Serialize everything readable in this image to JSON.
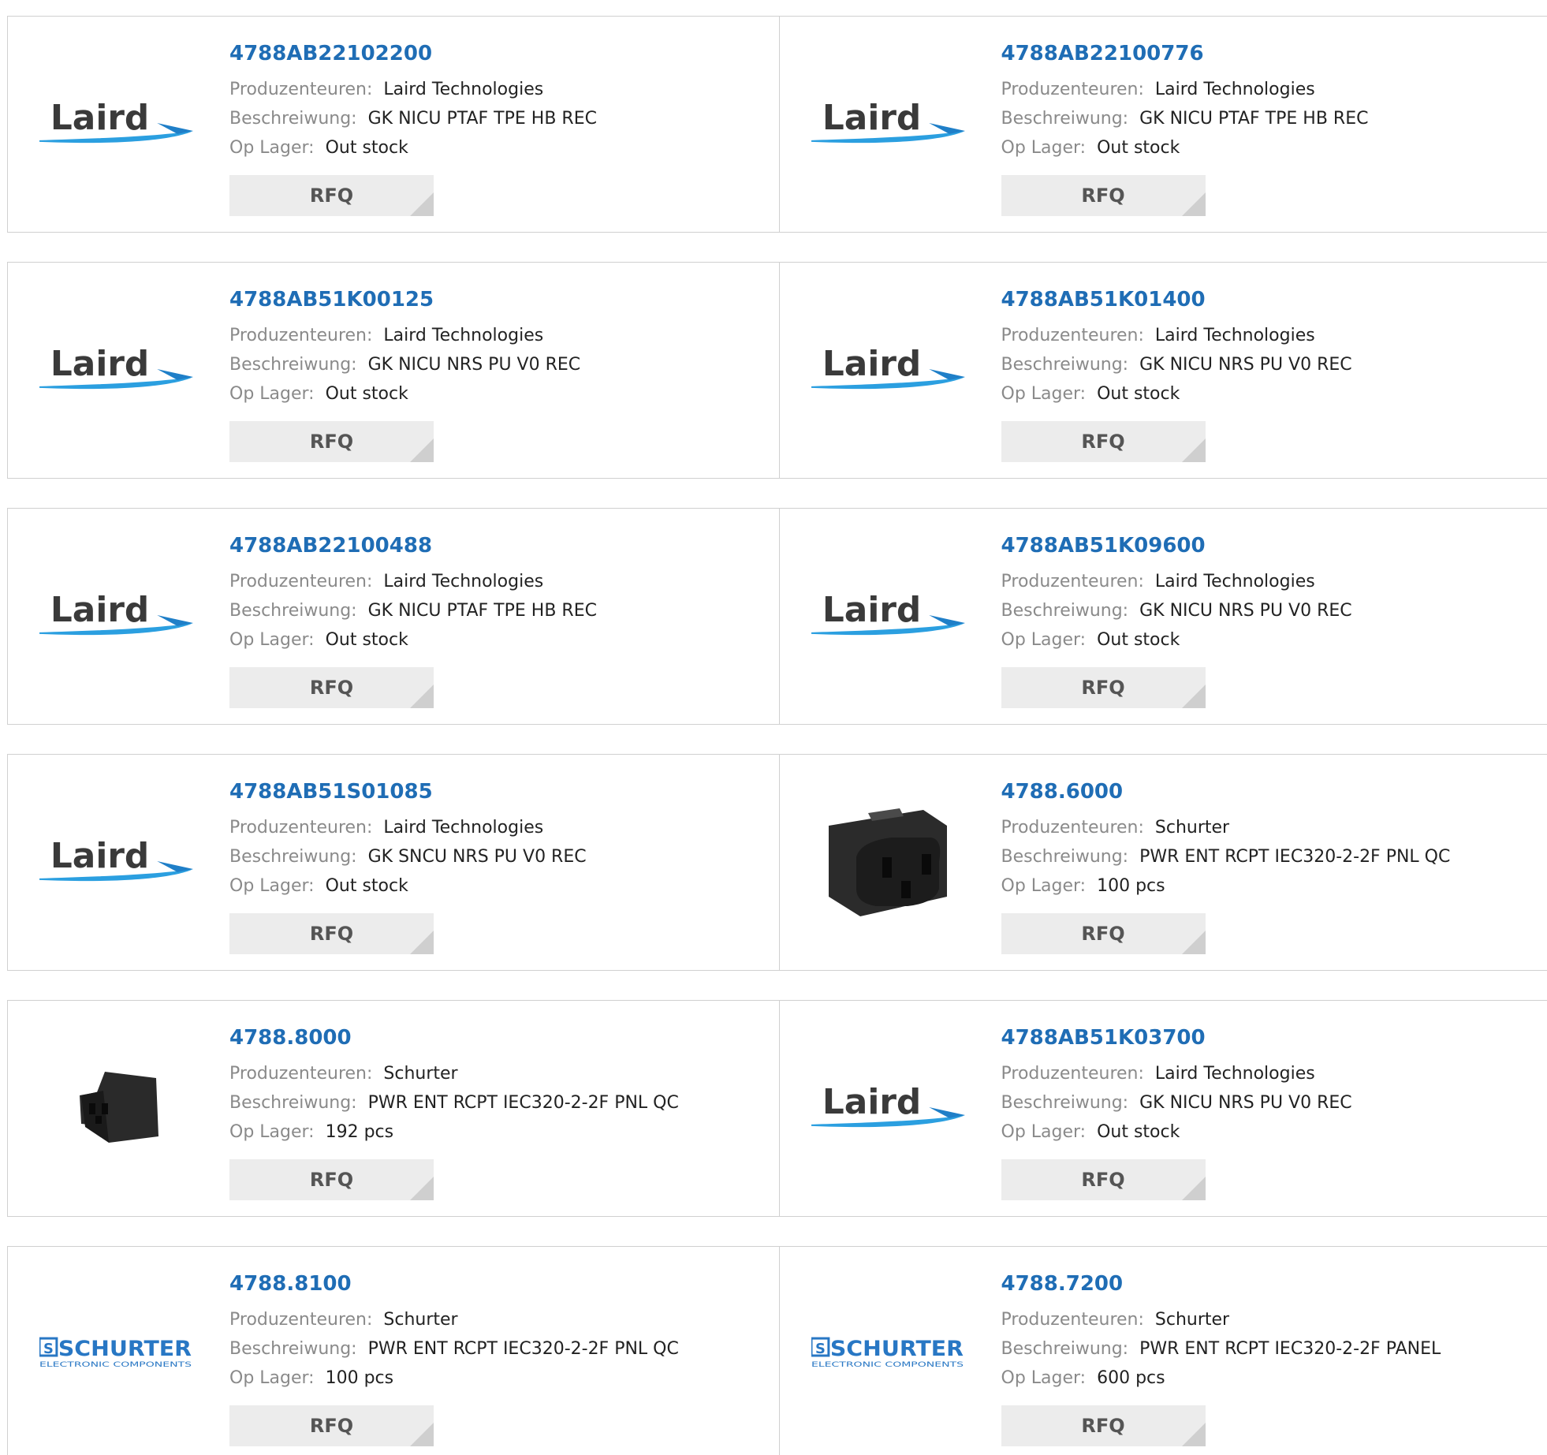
{
  "labels": {
    "manufacturer": "Produzenteuren:",
    "description": "Beschreiwung:",
    "stock": "Op Lager:",
    "rfq": "RFQ"
  },
  "brand": {
    "laird_word": "Laird",
    "schurter_word": "SCHURTER",
    "schurter_sub": "ELECTRONIC COMPONENTS",
    "link_color": "#1f6db5"
  },
  "products": [
    {
      "part": "4788AB22102200",
      "manufacturer": "Laird Technologies",
      "description": "GK NICU PTAF TPE HB REC",
      "stock": "Out stock",
      "image": "laird-logo"
    },
    {
      "part": "4788AB22100776",
      "manufacturer": "Laird Technologies",
      "description": "GK NICU PTAF TPE HB REC",
      "stock": "Out stock",
      "image": "laird-logo"
    },
    {
      "part": "4788AB51K00125",
      "manufacturer": "Laird Technologies",
      "description": "GK NICU NRS PU V0 REC",
      "stock": "Out stock",
      "image": "laird-logo"
    },
    {
      "part": "4788AB51K01400",
      "manufacturer": "Laird Technologies",
      "description": "GK NICU NRS PU V0 REC",
      "stock": "Out stock",
      "image": "laird-logo"
    },
    {
      "part": "4788AB22100488",
      "manufacturer": "Laird Technologies",
      "description": "GK NICU PTAF TPE HB REC",
      "stock": "Out stock",
      "image": "laird-logo"
    },
    {
      "part": "4788AB51K09600",
      "manufacturer": "Laird Technologies",
      "description": "GK NICU NRS PU V0 REC",
      "stock": "Out stock",
      "image": "laird-logo"
    },
    {
      "part": "4788AB51S01085",
      "manufacturer": "Laird Technologies",
      "description": "GK SNCU NRS PU V0 REC",
      "stock": "Out stock",
      "image": "laird-logo"
    },
    {
      "part": "4788.6000",
      "manufacturer": "Schurter",
      "description": "PWR ENT RCPT IEC320-2-2F PNL QC",
      "stock": "100 pcs",
      "image": "connector-photo-large"
    },
    {
      "part": "4788.8000",
      "manufacturer": "Schurter",
      "description": "PWR ENT RCPT IEC320-2-2F PNL QC",
      "stock": "192 pcs",
      "image": "connector-photo-small"
    },
    {
      "part": "4788AB51K03700",
      "manufacturer": "Laird Technologies",
      "description": "GK NICU NRS PU V0 REC",
      "stock": "Out stock",
      "image": "laird-logo"
    },
    {
      "part": "4788.8100",
      "manufacturer": "Schurter",
      "description": "PWR ENT RCPT IEC320-2-2F PNL QC",
      "stock": "100 pcs",
      "image": "schurter-logo"
    },
    {
      "part": "4788.7200",
      "manufacturer": "Schurter",
      "description": "PWR ENT RCPT IEC320-2-2F PANEL",
      "stock": "600 pcs",
      "image": "schurter-logo"
    }
  ]
}
